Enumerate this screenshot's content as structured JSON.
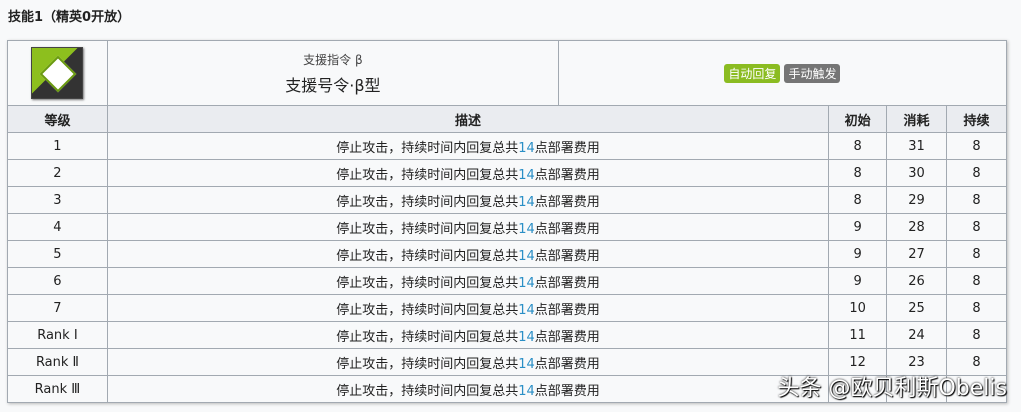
{
  "section_title": "技能1（精英0开放）",
  "skill": {
    "subtitle": "支援指令 β",
    "name": "支援号令·β型",
    "icon": "skill-c-plus-icon",
    "tags": [
      {
        "label": "自动回复",
        "color": "#8bbc21"
      },
      {
        "label": "手动触发",
        "color": "#757575"
      }
    ]
  },
  "headers": [
    "等级",
    "描述",
    "初始",
    "消耗",
    "持续"
  ],
  "desc": {
    "pre": "停止攻击，持续时间内回复总共",
    "num": "14",
    "post": "点部署费用"
  },
  "rows": [
    {
      "level": "1",
      "init": "8",
      "cost": "31",
      "dur": "8"
    },
    {
      "level": "2",
      "init": "8",
      "cost": "30",
      "dur": "8"
    },
    {
      "level": "3",
      "init": "8",
      "cost": "29",
      "dur": "8"
    },
    {
      "level": "4",
      "init": "9",
      "cost": "28",
      "dur": "8"
    },
    {
      "level": "5",
      "init": "9",
      "cost": "27",
      "dur": "8"
    },
    {
      "level": "6",
      "init": "9",
      "cost": "26",
      "dur": "8"
    },
    {
      "level": "7",
      "init": "10",
      "cost": "25",
      "dur": "8"
    },
    {
      "level": "Rank Ⅰ",
      "init": "11",
      "cost": "24",
      "dur": "8"
    },
    {
      "level": "Rank Ⅱ",
      "init": "12",
      "cost": "23",
      "dur": "8"
    },
    {
      "level": "Rank Ⅲ",
      "init": "",
      "cost": "",
      "dur": ""
    }
  ],
  "watermark": "头条 @欧贝利斯Obelis"
}
